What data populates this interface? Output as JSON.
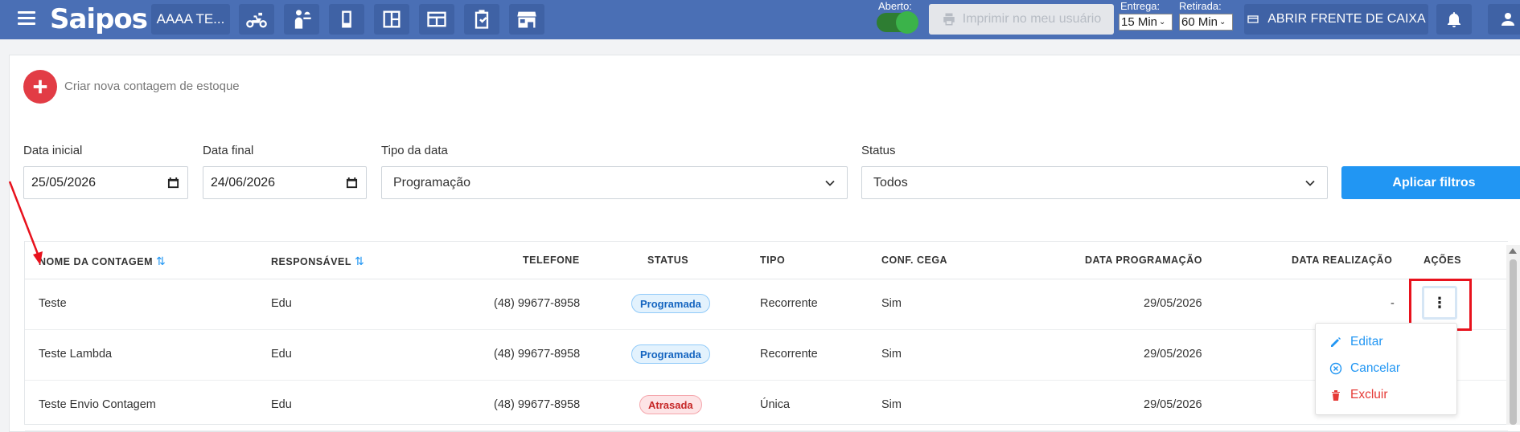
{
  "topbar": {
    "brand": "Saipos",
    "store_name": "AAAA TE...",
    "tool_icons": [
      "delivery-moto-icon",
      "waiter-service-icon",
      "phone-orders-icon",
      "layout-panel-icon",
      "kds-screen-icon",
      "checklist-icon",
      "store-icon"
    ],
    "aberto_label": "Aberto:",
    "print_label": "Imprimir no meu usuário",
    "entrega_label": "Entrega:",
    "entrega_value": "15 Min",
    "retirada_label": "Retirada:",
    "retirada_value": "60 Min",
    "open_register_label": "ABRIR FRENTE DE CAIXA",
    "bar_color": "#4a6fb5"
  },
  "create": {
    "label": "Criar nova contagem de estoque",
    "button_color": "#e23c45"
  },
  "filters": {
    "start_label": "Data inicial",
    "start_value": "25/05/2026",
    "end_label": "Data final",
    "end_value": "24/06/2026",
    "type_label": "Tipo da data",
    "type_value": "Programação",
    "status_label": "Status",
    "status_value": "Todos",
    "apply_label": "Aplicar filtros",
    "apply_color": "#2196f3"
  },
  "table": {
    "headers": {
      "name": "NOME DA CONTAGEM",
      "responsible": "RESPONSÁVEL",
      "phone": "TELEFONE",
      "status": "STATUS",
      "type": "TIPO",
      "blind": "CONF. CEGA",
      "scheduled": "DATA PROGRAMAÇÃO",
      "done": "DATA REALIZAÇÃO",
      "actions": "AÇÕES"
    },
    "rows": [
      {
        "name": "Teste",
        "responsible": "Edu",
        "phone": "(48) 99677-8958",
        "status": "Programada",
        "type": "Recorrente",
        "blind": "Sim",
        "scheduled": "29/05/2026",
        "done": "-"
      },
      {
        "name": "Teste Lambda",
        "responsible": "Edu",
        "phone": "(48) 99677-8958",
        "status": "Programada",
        "type": "Recorrente",
        "blind": "Sim",
        "scheduled": "29/05/2026",
        "done": ""
      },
      {
        "name": "Teste Envio Contagem",
        "responsible": "Edu",
        "phone": "(48) 99677-8958",
        "status": "Atrasada",
        "type": "Única",
        "blind": "Sim",
        "scheduled": "29/05/2026",
        "done": ""
      }
    ]
  },
  "actions_menu": {
    "edit": "Editar",
    "cancel": "Cancelar",
    "delete": "Excluir",
    "edit_color": "#2196f3",
    "delete_color": "#e53935"
  },
  "annotation": {
    "highlight_color": "#e8121d"
  }
}
